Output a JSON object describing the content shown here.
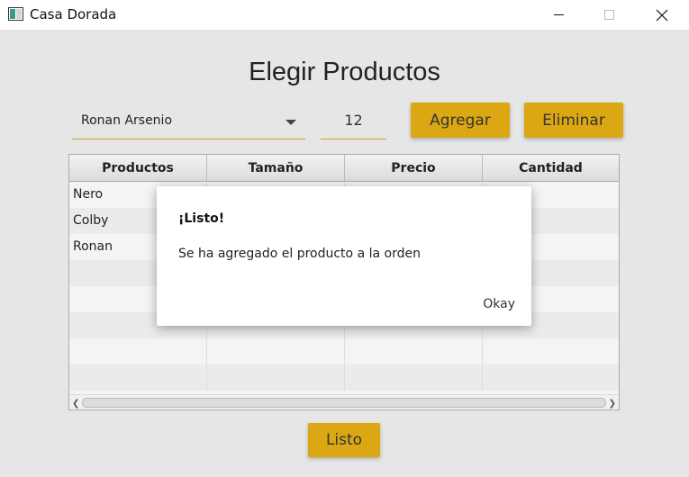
{
  "window": {
    "title": "Casa Dorada"
  },
  "page": {
    "title": "Elegir Productos"
  },
  "controls": {
    "product_selected": "Ronan Arsenio",
    "quantity": "12",
    "add_label": "Agregar",
    "remove_label": "Eliminar",
    "done_label": "Listo"
  },
  "table": {
    "columns": [
      "Productos",
      "Tamaño",
      "Precio",
      "Cantidad"
    ],
    "rows": [
      [
        "Nero",
        "",
        "",
        ""
      ],
      [
        "Colby",
        "",
        "",
        ""
      ],
      [
        "Ronan",
        "",
        "",
        ""
      ],
      [
        "",
        "",
        "",
        ""
      ],
      [
        "",
        "",
        "",
        ""
      ],
      [
        "",
        "",
        "",
        ""
      ],
      [
        "",
        "",
        "",
        ""
      ],
      [
        "",
        "",
        "",
        ""
      ]
    ]
  },
  "dialog": {
    "title": "¡Listo!",
    "message": "Se ha agregado el producto a la orden",
    "ok_label": "Okay"
  },
  "colors": {
    "accent": "#dba814",
    "underline": "#c9a227",
    "background": "#e6e6e6"
  }
}
